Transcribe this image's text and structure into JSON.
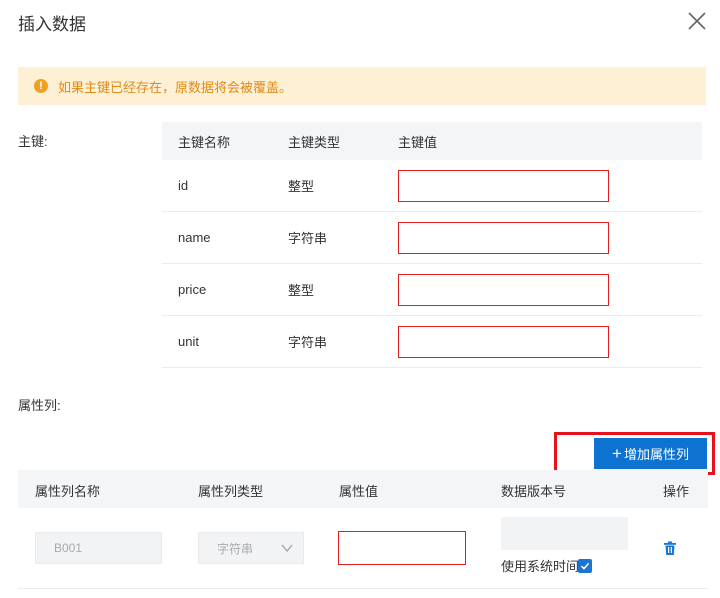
{
  "dialog": {
    "title": "插入数据",
    "close_icon": "close-icon"
  },
  "alert": {
    "icon": "warning-icon",
    "icon_glyph": "!",
    "text": "如果主键已经存在，原数据将会被覆盖。",
    "bg_color": "#fdf0d5",
    "text_color": "#e08a1a"
  },
  "primary_key": {
    "section_label": "主键:",
    "headers": [
      "主键名称",
      "主键类型",
      "主键值"
    ],
    "rows": [
      {
        "name": "id",
        "type": "整型",
        "value": ""
      },
      {
        "name": "name",
        "type": "字符串",
        "value": ""
      },
      {
        "name": "price",
        "type": "整型",
        "value": ""
      },
      {
        "name": "unit",
        "type": "字符串",
        "value": ""
      }
    ]
  },
  "attributes": {
    "section_label": "属性列:",
    "add_button": {
      "plus": "+",
      "label": "增加属性列",
      "color": "#0d72d0"
    },
    "headers": [
      "属性列名称",
      "属性列类型",
      "属性值",
      "数据版本号",
      "操作"
    ],
    "row": {
      "name": "B001",
      "type": "字符串",
      "value": "",
      "version": "",
      "use_system_time_label": "使用系统时间",
      "use_system_time_checked": true,
      "delete_icon": "trash-icon"
    }
  },
  "colors": {
    "error_border": "#e02020",
    "highlight_border": "#e8101a",
    "checkbox": "#1a76d2"
  }
}
